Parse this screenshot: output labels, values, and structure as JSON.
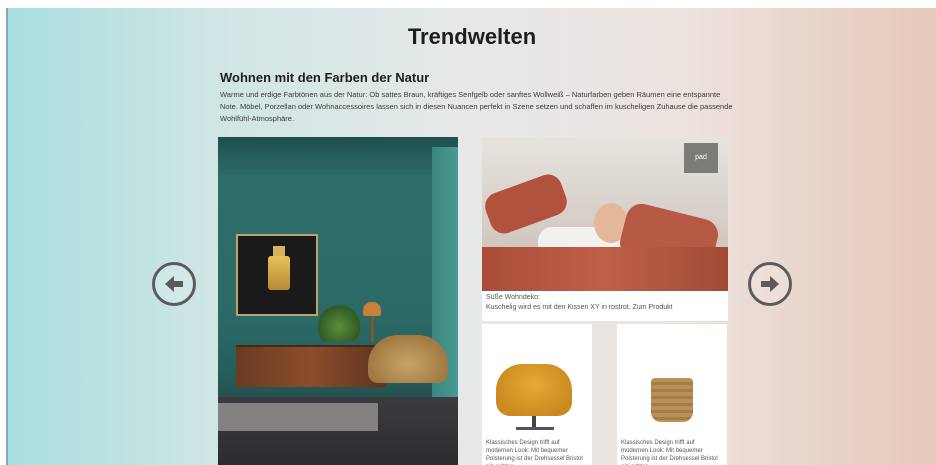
{
  "header": {
    "title": "Trendwelten"
  },
  "section": {
    "subtitle": "Wohnen mit den Farben der Natur",
    "description": "Warme und erdige Farbtönen aus der Natur: Ob sattes Braun, kräftiges Senfgelb oder sanftes Wollweiß – Naturfarben geben Räumen eine entspannte Note. Möbel, Porzellan oder Wohnaccessoires lassen sich in diesen Nuancen perfekt in Szene setzen und schaffen im kuscheligen Zuhause die passende Wohlfühl-Atmosphäre."
  },
  "carousel": {
    "prev_icon": "arrow-left-circle-icon",
    "next_icon": "arrow-right-circle-icon"
  },
  "products": {
    "top": {
      "brand": "pad",
      "caption_line1": "Süße Wohndeko:",
      "caption_line2": "Kuschelig wird es mit den Kissen XY in rostrot. Zum Produkt"
    },
    "chair": {
      "caption": "Klassisches Design trifft auf modernen Look: Mit bequemer Polsterung ist der Drehsessel Bristol ein echtes"
    },
    "pot": {
      "caption": "Klassisches Design trifft auf modernen Look: Mit bequemer Polsterung ist der Drehsessel Bristol ein echtes"
    }
  },
  "colors": {
    "gradient_left": "#a9dedd",
    "gradient_right": "#e6c9b8",
    "arrow": "#5b5b5b"
  }
}
